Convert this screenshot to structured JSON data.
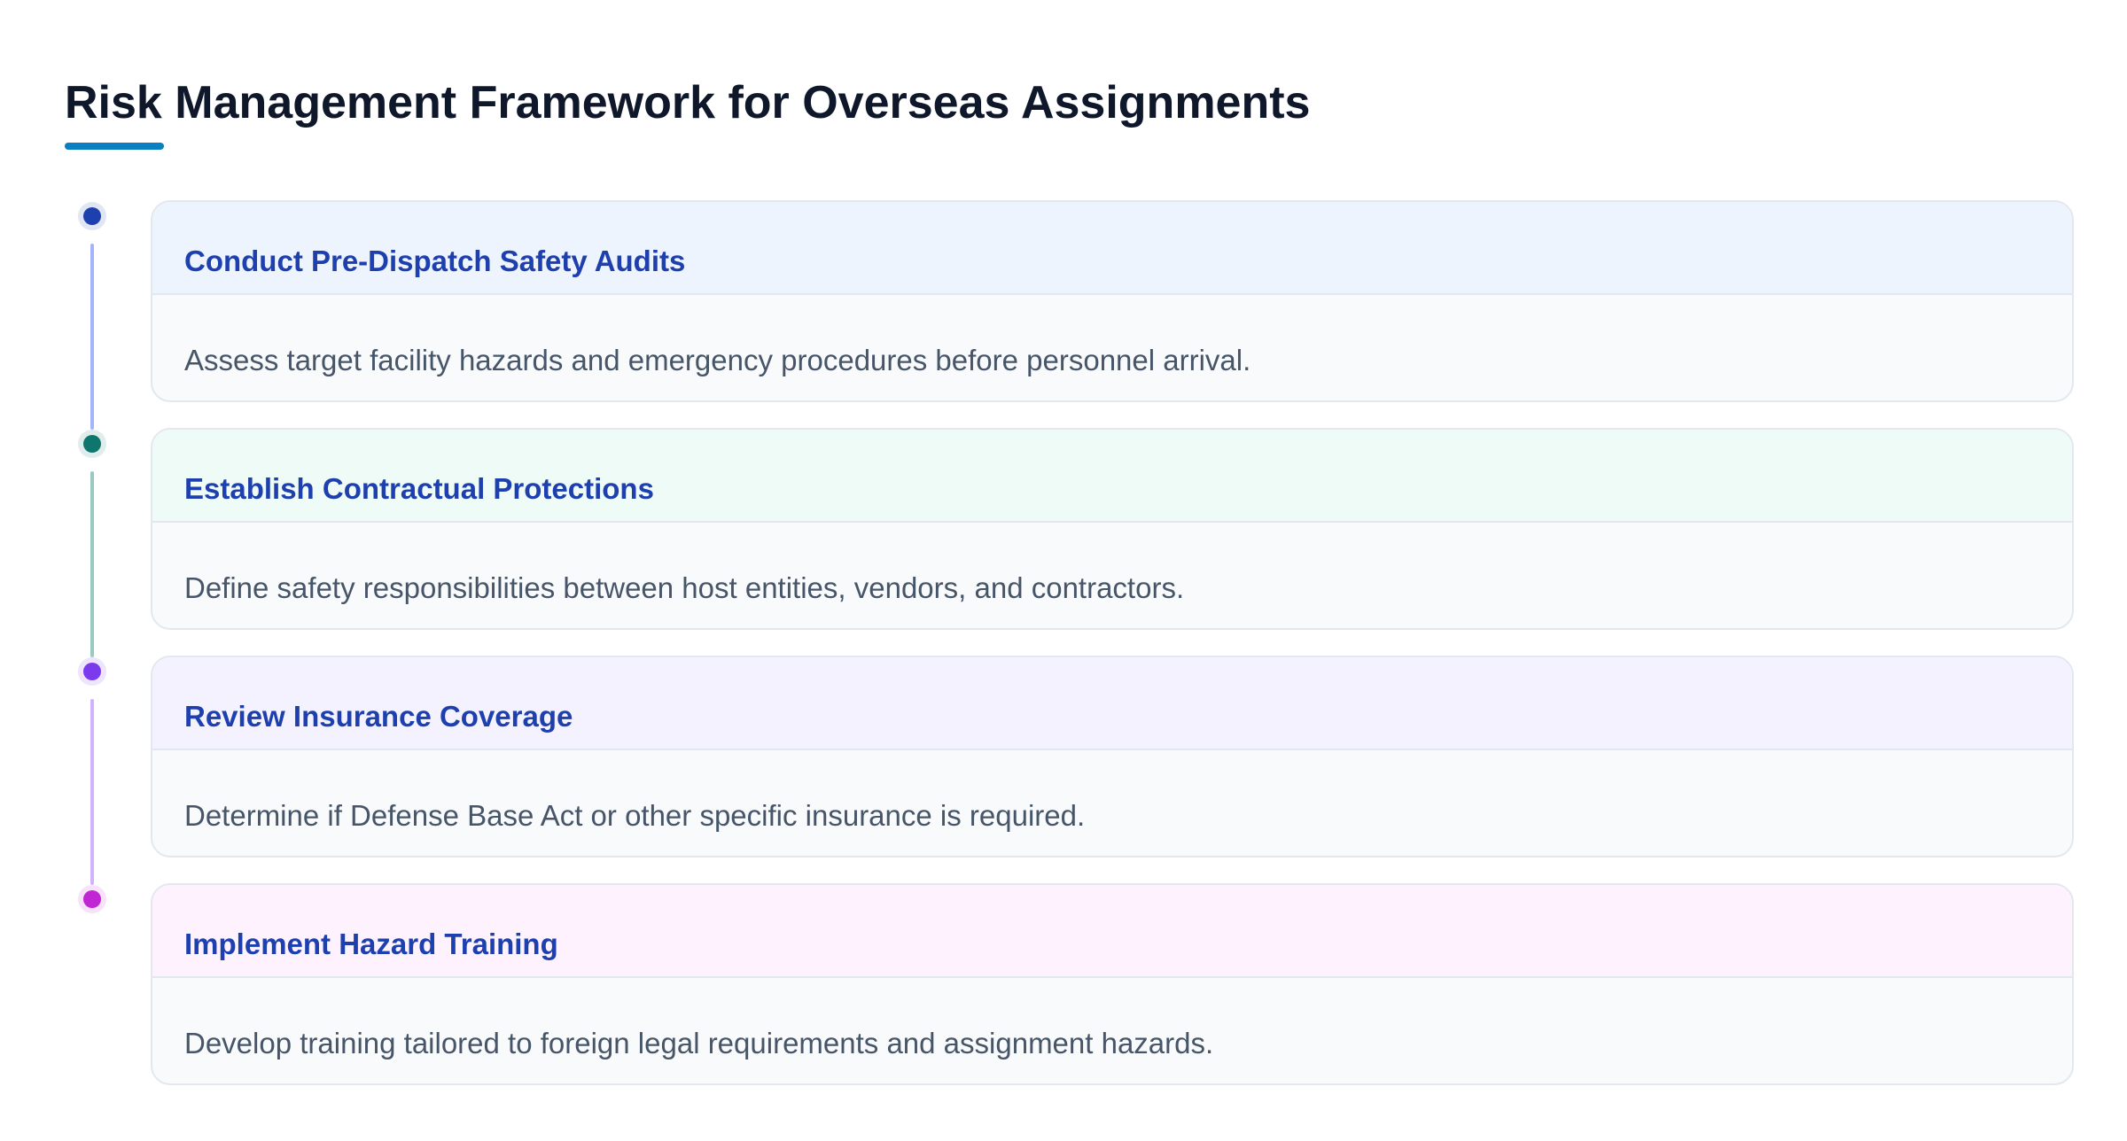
{
  "header": {
    "title": "Risk Management Framework for Overseas Assignments"
  },
  "accent_color": "#0a7fc2",
  "steps": [
    {
      "title": "Conduct Pre-Dispatch Safety Audits",
      "description": "Assess target facility hazards and emergency procedures before personnel arrival.",
      "dot_color": "#1e40af",
      "head_bg": "#eef4fe",
      "line_color": "#a5b4fc"
    },
    {
      "title": "Establish Contractual Protections",
      "description": "Define safety responsibilities between host entities, vendors, and contractors.",
      "dot_color": "#0f766e",
      "head_bg": "#eefbf7",
      "line_color": "#99c9c0"
    },
    {
      "title": "Review Insurance Coverage",
      "description": "Determine if Defense Base Act or other specific insurance is required.",
      "dot_color": "#7c3aed",
      "head_bg": "#f4f2fe",
      "line_color": "#d1b3fb"
    },
    {
      "title": "Implement Hazard Training",
      "description": "Develop training tailored to foreign legal requirements and assignment hazards.",
      "dot_color": "#c026d3",
      "head_bg": "#fdf2fe",
      "line_color": ""
    }
  ]
}
